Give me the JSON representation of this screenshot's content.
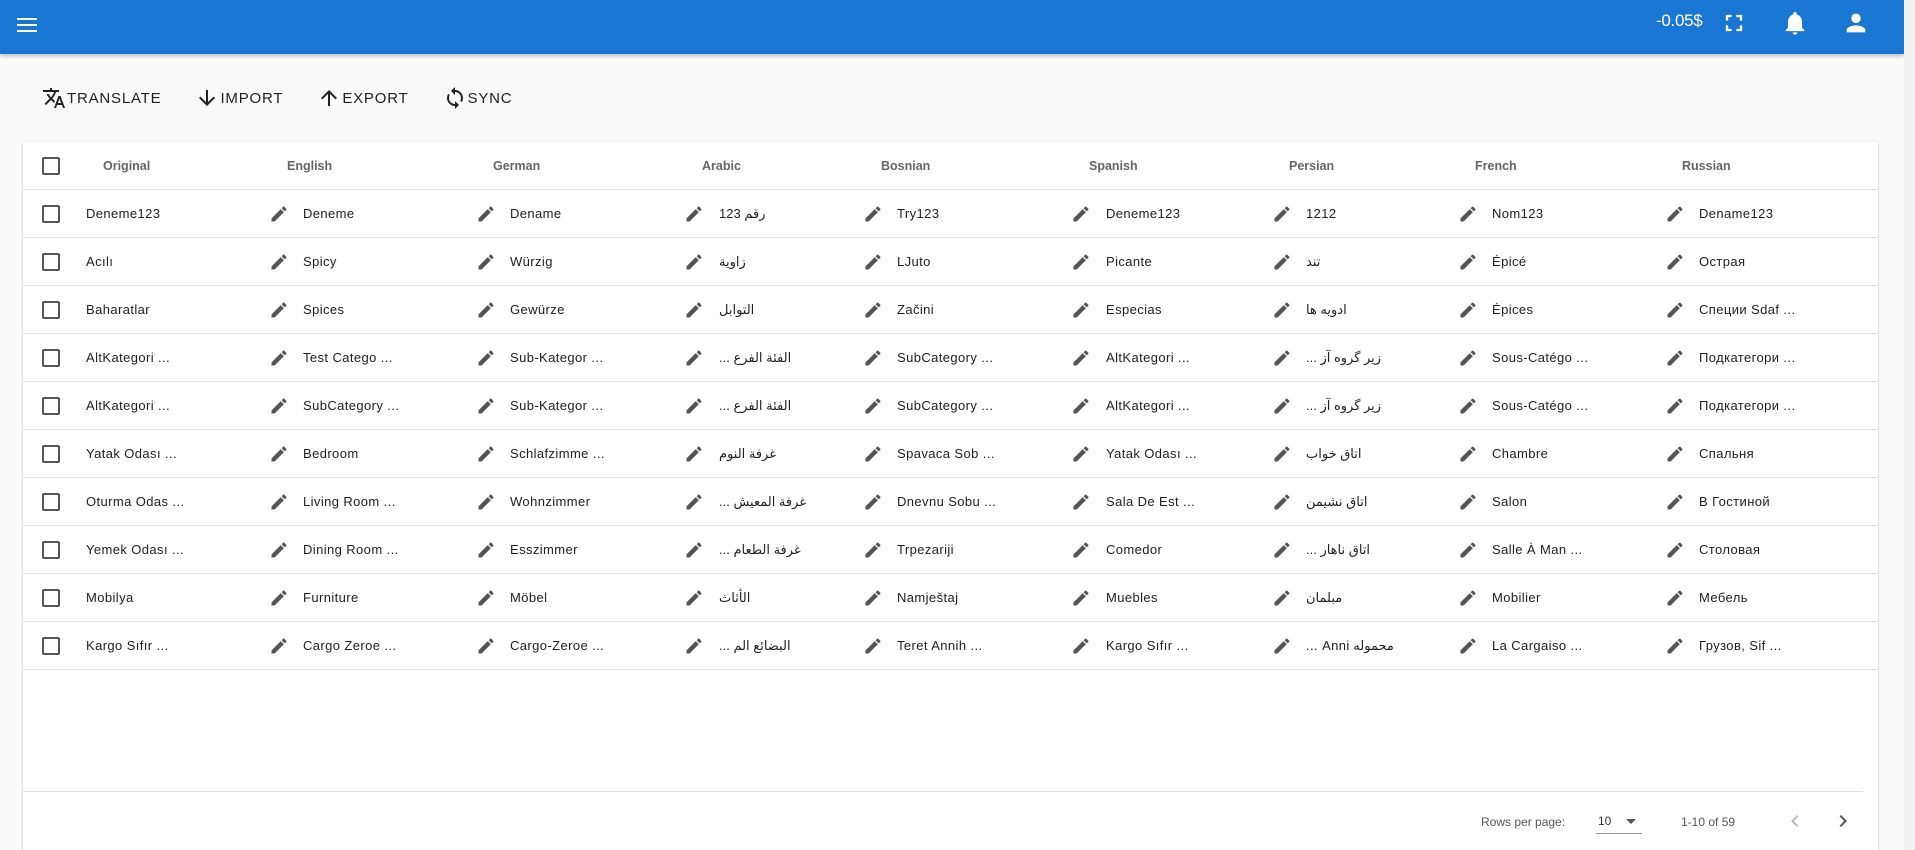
{
  "appbar": {
    "balance": "-0.05$",
    "icons": [
      "menu-icon",
      "fullscreen-icon",
      "bell-icon",
      "account-icon"
    ]
  },
  "toolbar": {
    "translate": "TRANSLATE",
    "import": "IMPORT",
    "export": "EXPORT",
    "sync": "SYNC"
  },
  "table": {
    "columns": [
      "Original",
      "English",
      "German",
      "Arabic",
      "Bosnian",
      "Spanish",
      "Persian",
      "French",
      "Russian"
    ],
    "rows": [
      [
        "Deneme123",
        "Deneme",
        "Dename",
        "رقم 123",
        "Try123",
        "Deneme123",
        "1212",
        "Nom123",
        "Dename123"
      ],
      [
        "Acılı",
        "Spicy",
        "Würzig",
        "زاوية",
        "LJuto",
        "Picante",
        "تند",
        "Épicé",
        "Острая"
      ],
      [
        "Baharatlar",
        "Spices",
        "Gewürze",
        "التوابل",
        "Začini",
        "Especias",
        "ادویه ها",
        "Épices",
        "Специи Sdaf ..."
      ],
      [
        "AltKategori ...",
        "Test Catego ...",
        "Sub-Kategor ...",
        "الفئة الفرع ...",
        "SubCategory ...",
        "AltKategori ...",
        "زیر گروه آز ...",
        "Sous-Catégo ...",
        "Подкатегори ..."
      ],
      [
        "AltKategori ...",
        "SubCategory ...",
        "Sub-Kategor ...",
        "الفئة الفرع ...",
        "SubCategory ...",
        "AltKategori ...",
        "زیر گروه آز ...",
        "Sous-Catégo ...",
        "Подкатегори ..."
      ],
      [
        "Yatak Odası ...",
        "Bedroom",
        "Schlafzimme ...",
        "غرفة النوم",
        "Spavaca Sob ...",
        "Yatak Odası ...",
        "اتاق خواب",
        "Chambre",
        "Спальня"
      ],
      [
        "Oturma Odas ...",
        "Living Room ...",
        "Wohnzimmer",
        "غرفة المعيش ...",
        "Dnevnu Sobu ...",
        "Sala De Est ...",
        "اتاق نشیمن",
        "Salon",
        "В Гостиной"
      ],
      [
        "Yemek Odası ...",
        "Dining Room ...",
        "Esszimmer",
        "غرفة الطعام ...",
        "Trpezariji",
        "Comedor",
        "اتاق ناهار ...",
        "Salle À Man ...",
        "Столовая"
      ],
      [
        "Mobilya",
        "Furniture",
        "Möbel",
        "الأثاث",
        "Namještaj",
        "Muebles",
        "مبلمان",
        "Mobilier",
        "Мебель"
      ],
      [
        "Kargo Sıfır ...",
        "Cargo Zeroe ...",
        "Cargo-Zeroe ...",
        "البضائع الم ...",
        "Teret Annih ...",
        "Kargo Sıfır ...",
        "محموله Anni ...",
        "La Cargaiso ...",
        "Грузов, Sif ..."
      ]
    ]
  },
  "pagination": {
    "rows_per_page_label": "Rows per page:",
    "rows_per_page_value": "10",
    "range": "1-10 of 59"
  }
}
